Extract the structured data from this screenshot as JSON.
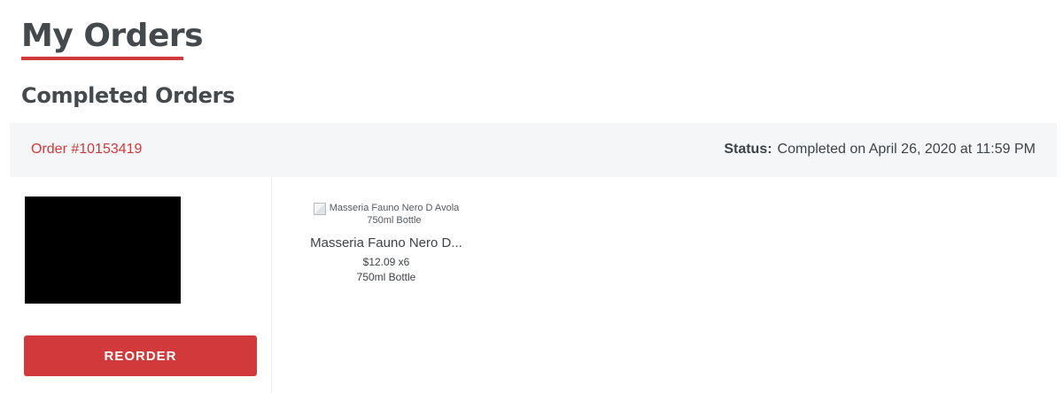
{
  "page": {
    "title": "My Orders",
    "section_title": "Completed Orders"
  },
  "order": {
    "number": "Order #10153419",
    "status_label": "Status:",
    "status_value": "Completed on April 26, 2020 at 11:59 PM",
    "reorder_label": "REORDER",
    "items": [
      {
        "image_alt_line1": "Masseria Fauno Nero D Avola",
        "image_alt_line2": "750ml Bottle",
        "name": "Masseria Fauno Nero D...",
        "price_qty": "$12.09 x6",
        "size": "750ml Bottle"
      }
    ]
  },
  "colors": {
    "accent": "#d2393a",
    "header_bg": "#f5f6f7",
    "text": "#3e4347"
  },
  "icons": {
    "broken_image": "broken-image-icon"
  }
}
